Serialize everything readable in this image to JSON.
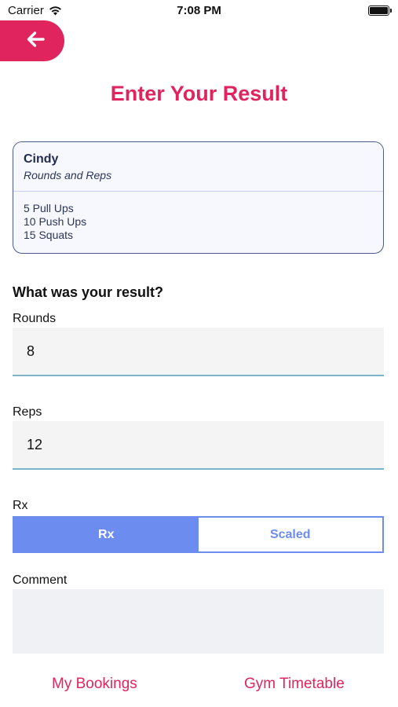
{
  "status_bar": {
    "carrier": "Carrier",
    "time": "7:08 PM"
  },
  "header": {
    "title": "Enter Your Result",
    "back_icon": "arrow-left-icon"
  },
  "workout": {
    "name": "Cindy",
    "type": "Rounds and Reps",
    "movements": [
      "5 Pull Ups",
      "10 Push Ups",
      "15 Squats"
    ]
  },
  "form": {
    "question": "What was your result?",
    "rounds": {
      "label": "Rounds",
      "value": "8"
    },
    "reps": {
      "label": "Reps",
      "value": "12"
    },
    "rx": {
      "label": "Rx",
      "options": [
        "Rx",
        "Scaled"
      ],
      "selected": "Rx"
    },
    "comment": {
      "label": "Comment",
      "value": ""
    }
  },
  "footer": {
    "my_bookings": "My Bookings",
    "gym_timetable": "Gym Timetable"
  },
  "colors": {
    "accent": "#e0245e",
    "segment_blue": "#6d8cf0",
    "card_border": "#4a5b8c"
  }
}
